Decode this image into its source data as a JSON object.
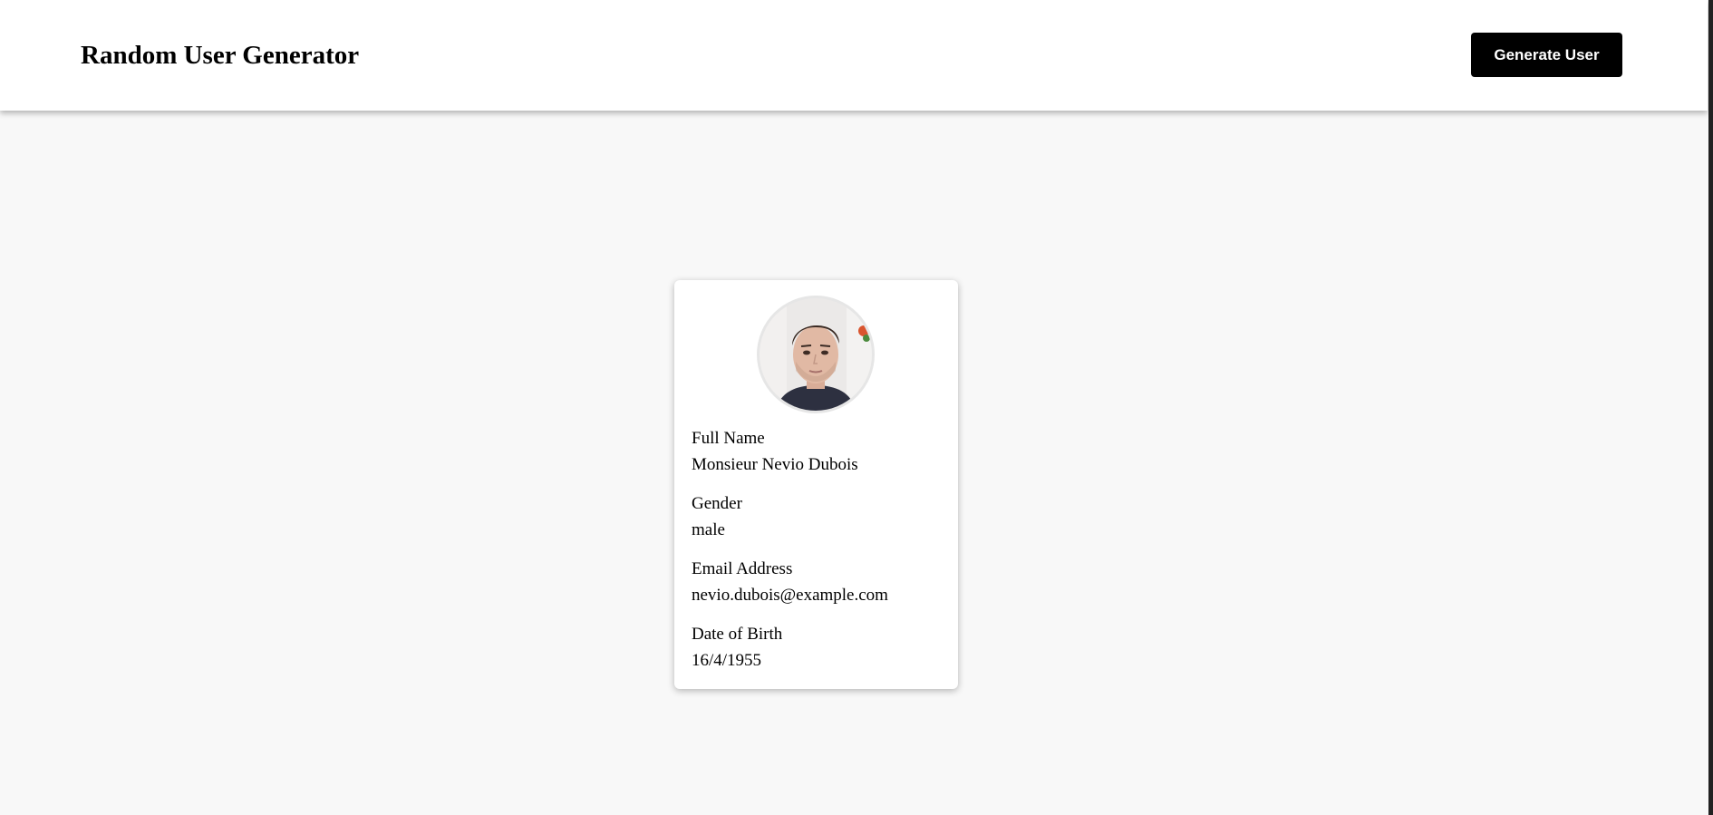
{
  "header": {
    "title": "Random User Generator",
    "generate_button_label": "Generate User"
  },
  "user": {
    "fields": [
      {
        "label": "Full Name",
        "value": "Monsieur Nevio Dubois"
      },
      {
        "label": "Gender",
        "value": "male"
      },
      {
        "label": "Email Address",
        "value": "nevio.dubois@example.com"
      },
      {
        "label": "Date of Birth",
        "value": "16/4/1955"
      }
    ]
  },
  "colors": {
    "page_background": "#f8f8f8",
    "header_background": "#ffffff",
    "button_background": "#000000",
    "button_text": "#ffffff",
    "card_background": "#ffffff"
  }
}
